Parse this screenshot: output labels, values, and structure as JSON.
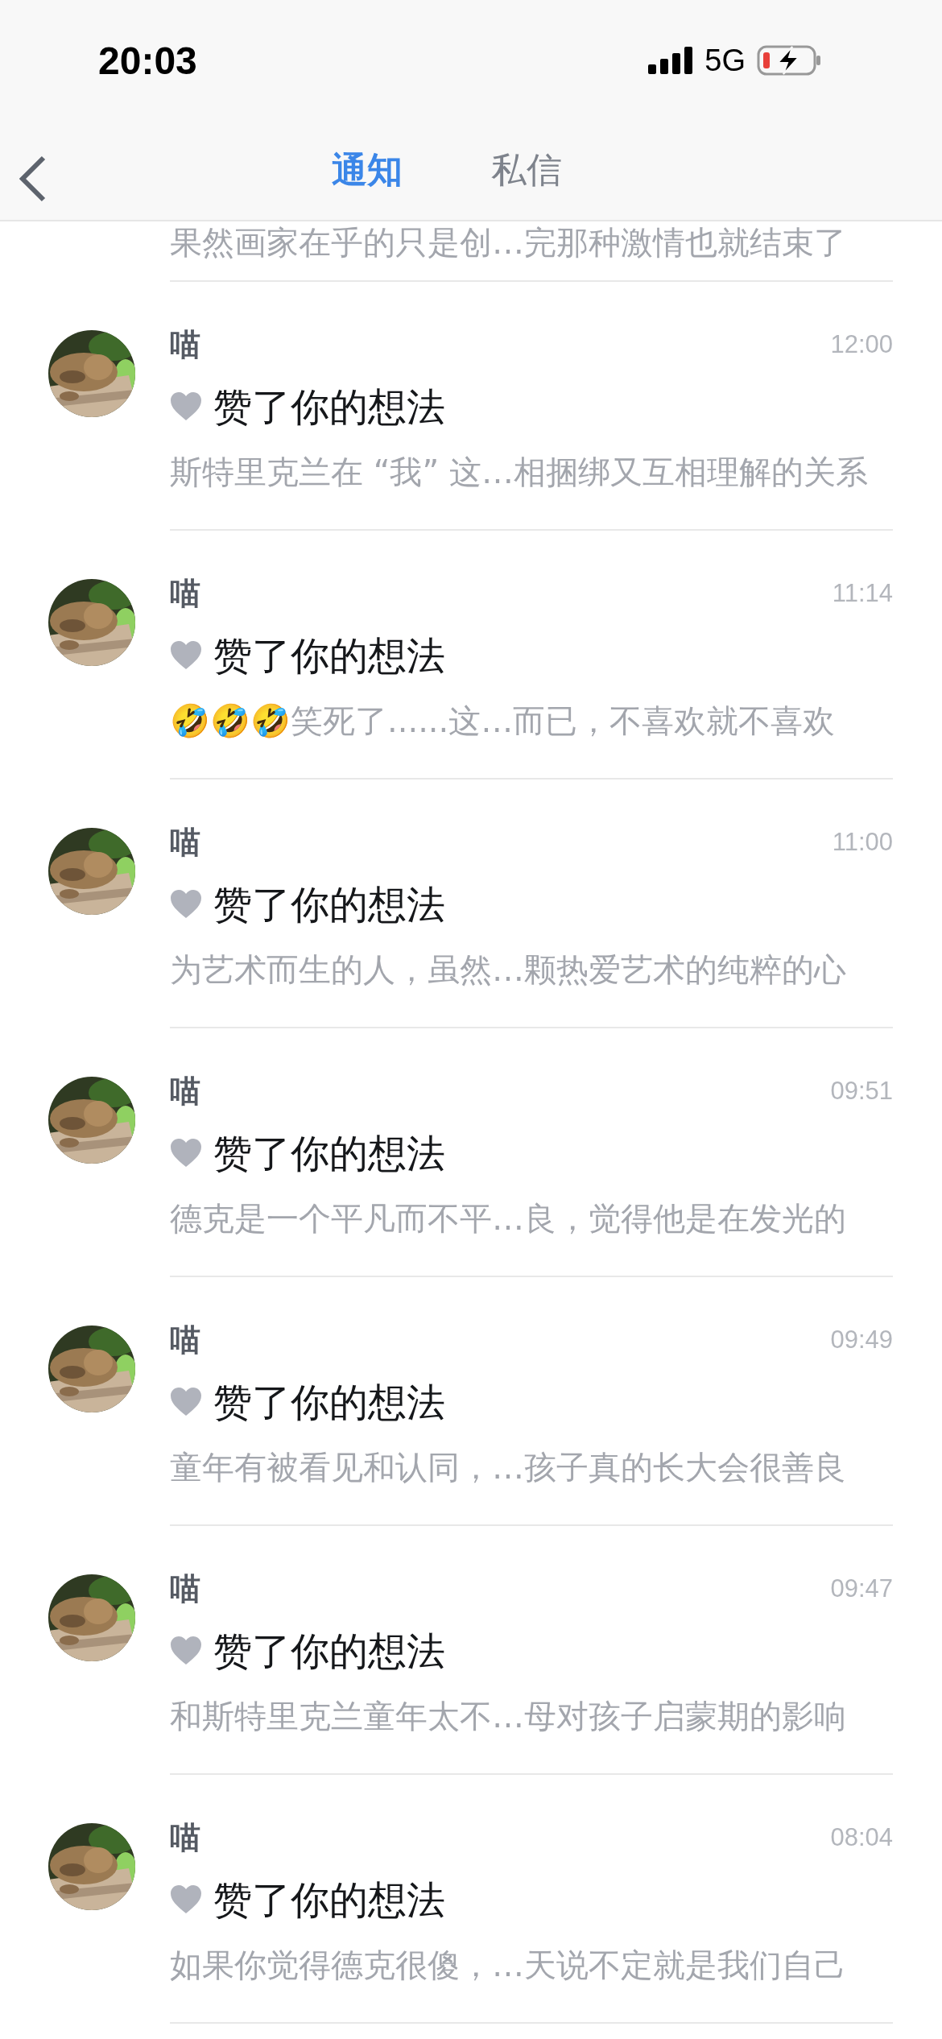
{
  "status_bar": {
    "time": "20:03",
    "network": "5G"
  },
  "nav": {
    "tabs": [
      {
        "label": "通知",
        "selected": true
      },
      {
        "label": "私信",
        "selected": false
      }
    ]
  },
  "partial_item": {
    "snippet": "果然画家在乎的只是创…完那种激情也就结束了"
  },
  "notifications": [
    {
      "name": "喵",
      "time": "12:00",
      "action": "赞了你的想法",
      "snippet": "斯特里克兰在 “我” 这…相捆绑又互相理解的关系"
    },
    {
      "name": "喵",
      "time": "11:14",
      "action": "赞了你的想法",
      "snippet": "🤣🤣🤣笑死了......这…而已，不喜欢就不喜欢"
    },
    {
      "name": "喵",
      "time": "11:00",
      "action": "赞了你的想法",
      "snippet": "为艺术而生的人，虽然…颗热爱艺术的纯粹的心"
    },
    {
      "name": "喵",
      "time": "09:51",
      "action": "赞了你的想法",
      "snippet": "德克是一个平凡而不平…良，觉得他是在发光的"
    },
    {
      "name": "喵",
      "time": "09:49",
      "action": "赞了你的想法",
      "snippet": "童年有被看见和认同，…孩子真的长大会很善良"
    },
    {
      "name": "喵",
      "time": "09:47",
      "action": "赞了你的想法",
      "snippet": "和斯特里克兰童年太不…母对孩子启蒙期的影响"
    },
    {
      "name": "喵",
      "time": "08:04",
      "action": "赞了你的想法",
      "snippet": "如果你觉得德克很傻，…天说不定就是我们自己"
    }
  ]
}
